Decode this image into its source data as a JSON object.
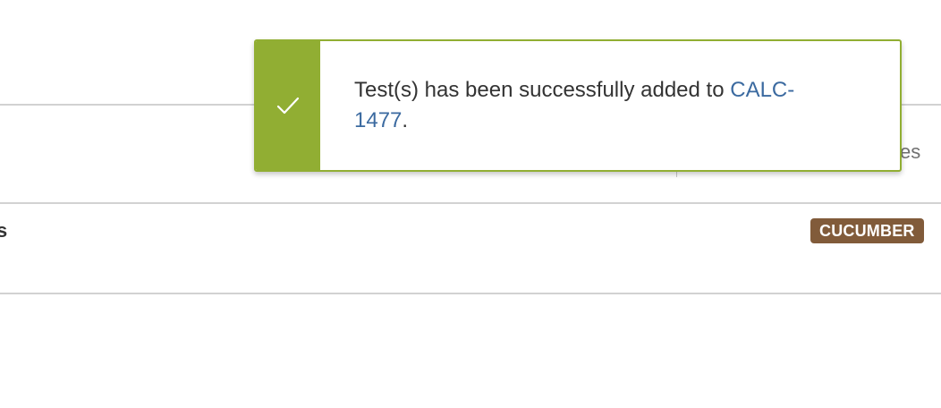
{
  "table": {
    "header_partial_label": "es",
    "row_partial_label": "s",
    "badge_label": "CUCUMBER"
  },
  "toast": {
    "status": "success",
    "icon": "checkmark-icon",
    "message_before": "Test(s) has been successfully added to ",
    "issue_link": "CALC-1477",
    "message_after": ".",
    "accent_color": "#91ae33",
    "link_color": "#3b6aa0"
  },
  "colors": {
    "badge_bg": "#815b3a"
  }
}
